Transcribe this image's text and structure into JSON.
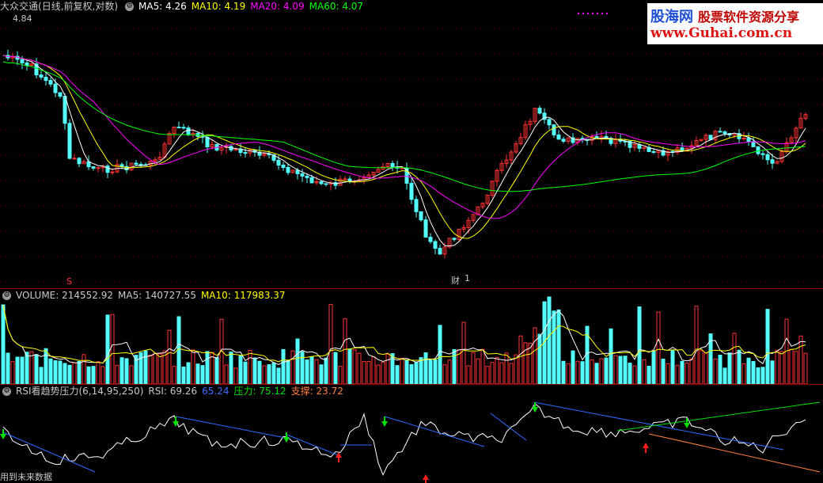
{
  "price_pane": {
    "stock": "大众交通",
    "period_info": "(日线,前复权,对数)",
    "ma5": "MA5: 4.26",
    "ma10": "MA10: 4.19",
    "ma20": "MA20: 4.09",
    "ma60": "MA60: 4.07",
    "high_label": "4.84",
    "low_label": "财",
    "low_value": "1",
    "marker_s": "S",
    "colors": {
      "ma5": "#ffffff",
      "ma10": "#ffff00",
      "ma20": "#ff00ff",
      "ma60": "#00ff00",
      "up": "#ff3232",
      "down": "#54ffff"
    }
  },
  "volume_pane": {
    "volume": "VOLUME: 214552.92",
    "ma5": "MA5: 140727.55",
    "ma10": "MA10: 117983.37"
  },
  "rsi_pane": {
    "title": "RSI看趋势压力(6,14,95,250)",
    "rsi": "RSI: 69.26",
    "rsi2": "65.24",
    "pressure": "压力: 75.12",
    "support": "支撑: 23.72",
    "footer": "用到未来数据"
  },
  "watermark": {
    "brand": "股海网",
    "tagline": "股票软件资源分享",
    "url": "www.Guhai.com.cn"
  }
}
